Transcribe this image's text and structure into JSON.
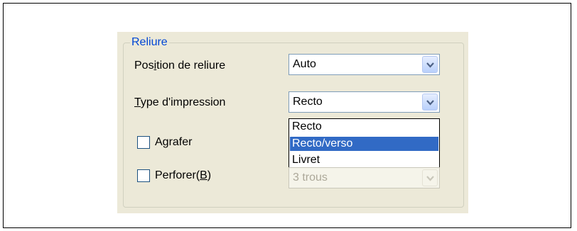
{
  "group": {
    "title": "Reliure"
  },
  "binding_position": {
    "label_pre": "Pos",
    "label_mnemonic": "i",
    "label_post": "tion de reliure",
    "value": "Auto"
  },
  "print_type": {
    "label_mnemonic": "T",
    "label_post": "ype d'impression",
    "value": "Recto",
    "options": [
      "Recto",
      "Recto/verso",
      "Livret"
    ],
    "highlighted_option": "Recto/verso"
  },
  "staple": {
    "label": "Agrafer",
    "checked": false
  },
  "punch": {
    "label_pre": "Perforer(",
    "label_mnemonic": "B",
    "label_post": ")",
    "checked": false,
    "value": "3 trous",
    "disabled": true
  },
  "colors": {
    "selection": "#316ac5",
    "group_title": "#0046d5",
    "panel": "#ece9d8"
  },
  "icons": {
    "dropdown_arrow": "chevron-down-icon"
  }
}
